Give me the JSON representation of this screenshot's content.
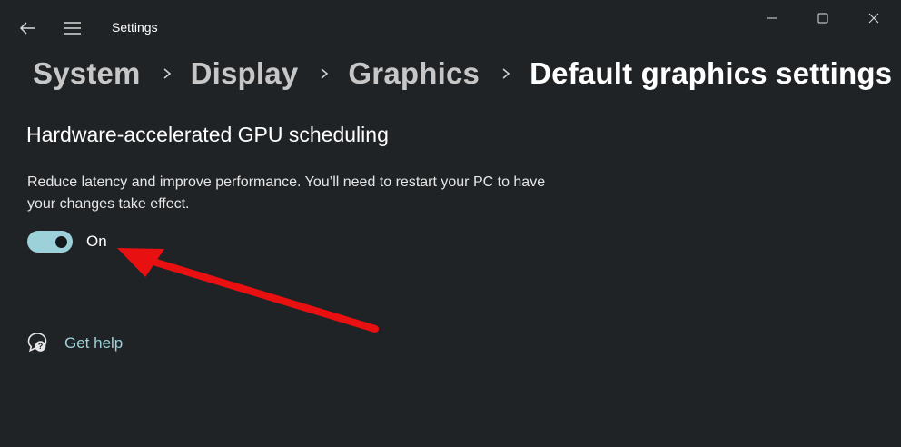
{
  "window": {
    "title": "Settings",
    "controls": {
      "minimize": "minimize-icon",
      "maximize": "maximize-icon",
      "close": "close-icon"
    }
  },
  "nav": {
    "back": "back-arrow-icon",
    "menu": "hamburger-menu-icon"
  },
  "breadcrumb": {
    "items": [
      "System",
      "Display",
      "Graphics"
    ],
    "current": "Default graphics settings",
    "separator": "chevron-right-icon"
  },
  "gpu_scheduling": {
    "title": "Hardware-accelerated GPU scheduling",
    "description": "Reduce latency and improve performance. You’ll need to restart your PC to have your changes take effect.",
    "toggle_state": "On",
    "toggle_on": true
  },
  "help": {
    "label": "Get help",
    "icon": "help-chat-icon"
  },
  "annotation": {
    "arrow_color": "#e81010"
  },
  "colors": {
    "background": "#202326",
    "accent": "#9dd1d9",
    "text": "#ffffff",
    "muted_text": "#c7c7c7"
  }
}
